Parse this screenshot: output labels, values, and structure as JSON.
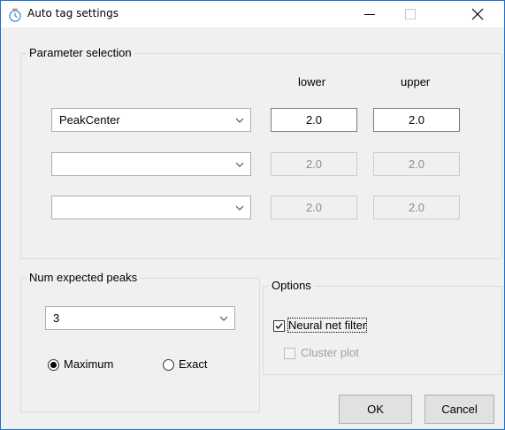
{
  "window": {
    "title": "Auto tag settings",
    "controls": {
      "minimize": "–",
      "maximize": "☐",
      "close": "✕"
    }
  },
  "parameter_selection": {
    "legend": "Parameter selection",
    "col_lower": "lower",
    "col_upper": "upper",
    "rows": [
      {
        "param": "PeakCenter",
        "lower": "2.0",
        "upper": "2.0",
        "enabled": true
      },
      {
        "param": "",
        "lower": "2.0",
        "upper": "2.0",
        "enabled": false
      },
      {
        "param": "",
        "lower": "2.0",
        "upper": "2.0",
        "enabled": false
      }
    ]
  },
  "num_expected_peaks": {
    "legend": "Num expected peaks",
    "value": "3",
    "radio_maximum": "Maximum",
    "radio_exact": "Exact",
    "selected": "Maximum"
  },
  "options": {
    "legend": "Options",
    "neural_net_filter": {
      "label": "Neural net filter",
      "checked": true
    },
    "cluster_plot": {
      "label": "Cluster plot",
      "checked": false,
      "enabled": false
    }
  },
  "buttons": {
    "ok": "OK",
    "cancel": "Cancel"
  },
  "icons": {
    "title": "timer-icon",
    "dropdown": "chevron-down-icon"
  }
}
